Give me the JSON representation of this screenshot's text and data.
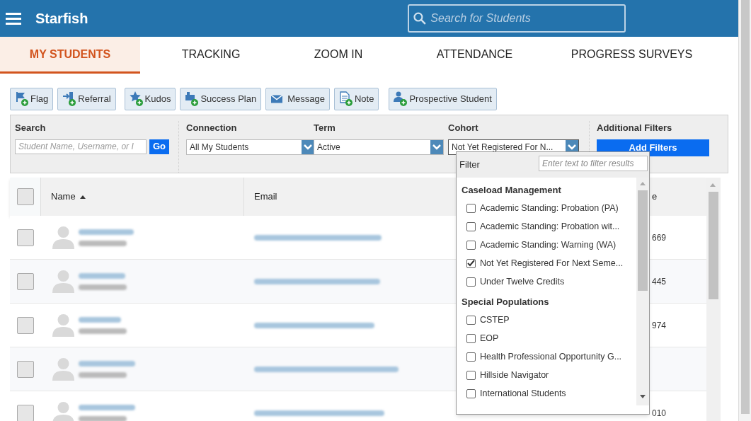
{
  "header": {
    "app_title": "Starfish",
    "search": {
      "placeholder": "Search for Students"
    }
  },
  "tabs": [
    {
      "label": "MY STUDENTS",
      "selected": true
    },
    {
      "label": "TRACKING",
      "selected": false
    },
    {
      "label": "ZOOM IN",
      "selected": false
    },
    {
      "label": "ATTENDANCE",
      "selected": false
    },
    {
      "label": "PROGRESS SURVEYS",
      "selected": false
    }
  ],
  "toolbar": [
    {
      "label": "Flag",
      "kind": "flag"
    },
    {
      "label": "Referral",
      "kind": "referral"
    },
    {
      "label": "Kudos",
      "kind": "kudos"
    },
    {
      "label": "Success Plan",
      "kind": "plan"
    },
    {
      "label": "Message",
      "kind": "message"
    },
    {
      "label": "Note",
      "kind": "note"
    },
    {
      "label": "Prospective Student",
      "kind": "person"
    }
  ],
  "filters": {
    "search": {
      "label": "Search",
      "placeholder": "Student Name, Username, or I",
      "button": "Go"
    },
    "connection": {
      "label": "Connection",
      "value": "All My Students"
    },
    "term": {
      "label": "Term",
      "value": "Active"
    },
    "cohort": {
      "label": "Cohort",
      "value": "Not Yet Registered For N..."
    },
    "additional": {
      "label": "Additional Filters",
      "button": "Add Filters"
    }
  },
  "table": {
    "select_all_checked": false,
    "columns": [
      {
        "label": "Name",
        "sorted": true
      },
      {
        "label": "Email",
        "sorted": false
      },
      {
        "label": "e",
        "sorted": false
      }
    ],
    "rows": [
      {
        "checked": false,
        "column_3": "669"
      },
      {
        "checked": false,
        "column_3": "445"
      },
      {
        "checked": false,
        "column_3": "974"
      },
      {
        "checked": false
      },
      {
        "checked": false,
        "column_3": "010"
      }
    ]
  },
  "cohort_dropdown": {
    "filter_label": "Filter",
    "filter_placeholder": "Enter text to filter results",
    "groups": [
      {
        "label": "Caseload Management",
        "items": [
          {
            "label": "Academic Standing: Probation (PA)",
            "checked": false
          },
          {
            "label": "Academic Standing: Probation wit...",
            "checked": false
          },
          {
            "label": "Academic Standing: Warning (WA)",
            "checked": false
          },
          {
            "label": "Not Yet Registered For Next Seme...",
            "checked": true
          },
          {
            "label": "Under Twelve Credits",
            "checked": false
          }
        ]
      },
      {
        "label": "Special Populations",
        "items": [
          {
            "label": "CSTEP",
            "checked": false
          },
          {
            "label": "EOP",
            "checked": false
          },
          {
            "label": "Health Professional Opportunity G...",
            "checked": false
          },
          {
            "label": "Hillside Navigator",
            "checked": false
          },
          {
            "label": "International Students",
            "checked": false
          }
        ]
      }
    ]
  }
}
